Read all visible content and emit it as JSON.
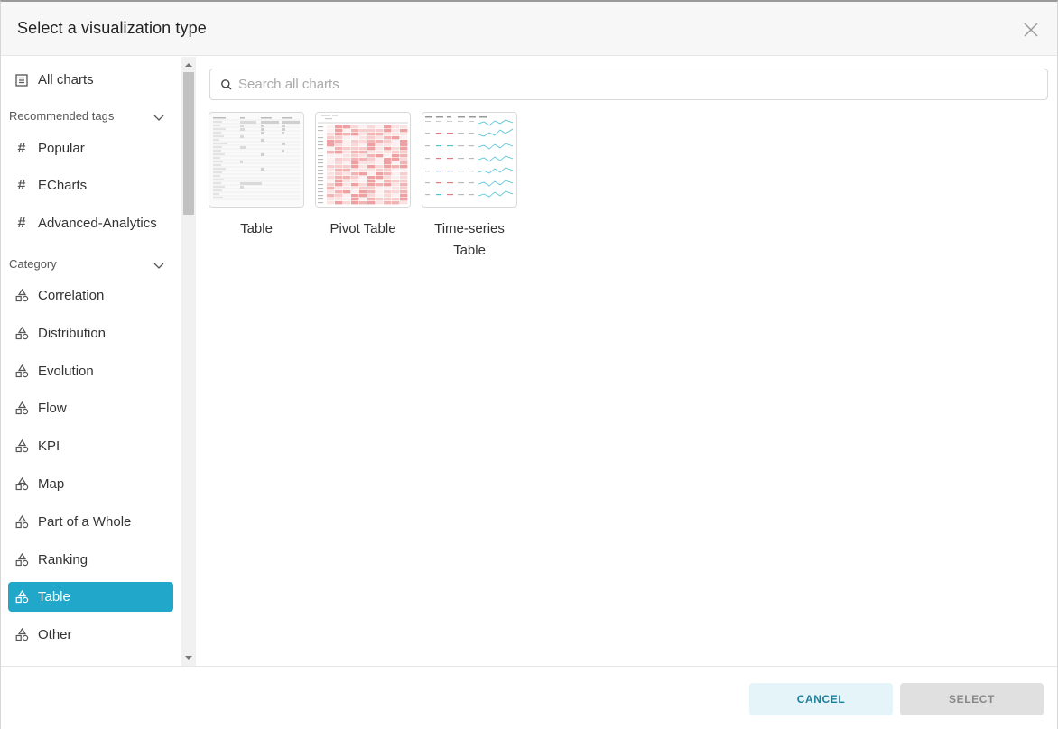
{
  "modal": {
    "title": "Select a visualization type"
  },
  "sidebar": {
    "all_charts": "All charts",
    "recommended_tags_label": "Recommended tags",
    "tags": [
      "Popular",
      "ECharts",
      "Advanced-Analytics"
    ],
    "category_label": "Category",
    "categories": [
      "Correlation",
      "Distribution",
      "Evolution",
      "Flow",
      "KPI",
      "Map",
      "Part of a Whole",
      "Ranking",
      "Table",
      "Other"
    ],
    "active_category": "Table"
  },
  "search": {
    "placeholder": "Search all charts",
    "value": ""
  },
  "charts": [
    {
      "label": "Table"
    },
    {
      "label": "Pivot Table"
    },
    {
      "label_line1": "Time-series",
      "label_line2": "Table"
    }
  ],
  "footer": {
    "cancel_label": "CANCEL",
    "select_label": "SELECT"
  },
  "colors": {
    "accent": "#20a7c9",
    "cancel_bg": "#e5f4f8",
    "cancel_text": "#1c7f99",
    "select_bg": "#e0e0e0"
  },
  "icons": {
    "all_charts": "chart-list-icon",
    "tag": "hash-icon",
    "category": "shapes-icon",
    "search": "search-icon",
    "close": "close-icon",
    "chevron": "chevron-down-icon"
  }
}
